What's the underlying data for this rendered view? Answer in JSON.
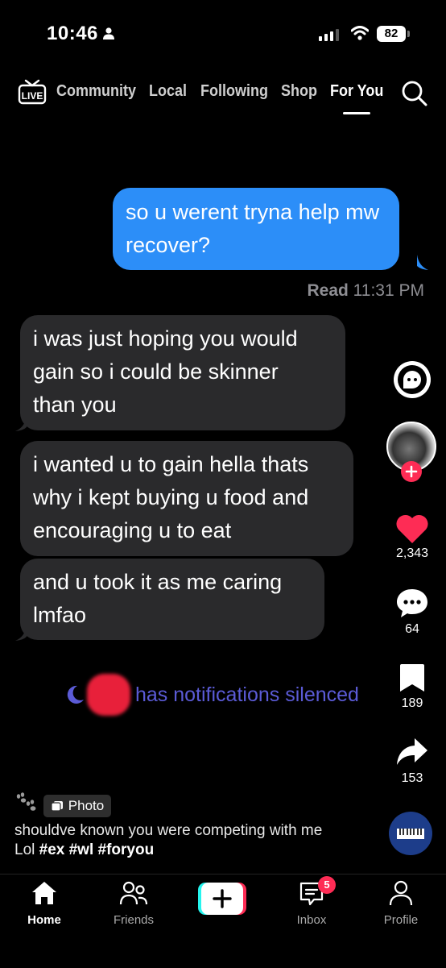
{
  "status_bar": {
    "time": "10:46",
    "battery": "82"
  },
  "nav": {
    "live": "LIVE",
    "tabs": [
      "Community",
      "Local",
      "Following",
      "Shop",
      "For You"
    ],
    "active_tab": "For You"
  },
  "messages": [
    {
      "from": "me",
      "lines": [
        "so u werent tryna help mw",
        "recover?"
      ]
    },
    {
      "from": "them",
      "lines": [
        "i was just hoping you would",
        "gain so i could be skinner",
        "than you"
      ]
    },
    {
      "from": "them",
      "lines": [
        "i wanted u to gain hella thats",
        "why i kept buying u food and",
        "encouraging u to eat"
      ]
    },
    {
      "from": "them",
      "lines": [
        "and u took it as me caring",
        "lmfao"
      ]
    }
  ],
  "read_receipt": {
    "label": "Read",
    "time": "11:31 PM"
  },
  "silenced_text": "has notifications silenced",
  "rail": {
    "likes": "2,343",
    "comments": "64",
    "saves": "189",
    "shares": "153"
  },
  "post": {
    "tag": "Photo",
    "caption_text": "shouldve known you were competing with me Lol",
    "hashtags": "#ex #wl #foryou"
  },
  "tabbar": {
    "home": "Home",
    "friends": "Friends",
    "inbox": "Inbox",
    "profile": "Profile",
    "inbox_badge": "5"
  },
  "colors": {
    "imessage_blue": "#2c8ef8",
    "bubble_gray": "#2a2a2c",
    "like_red": "#fe2c55",
    "silenced_purple": "#5b5bd6"
  }
}
